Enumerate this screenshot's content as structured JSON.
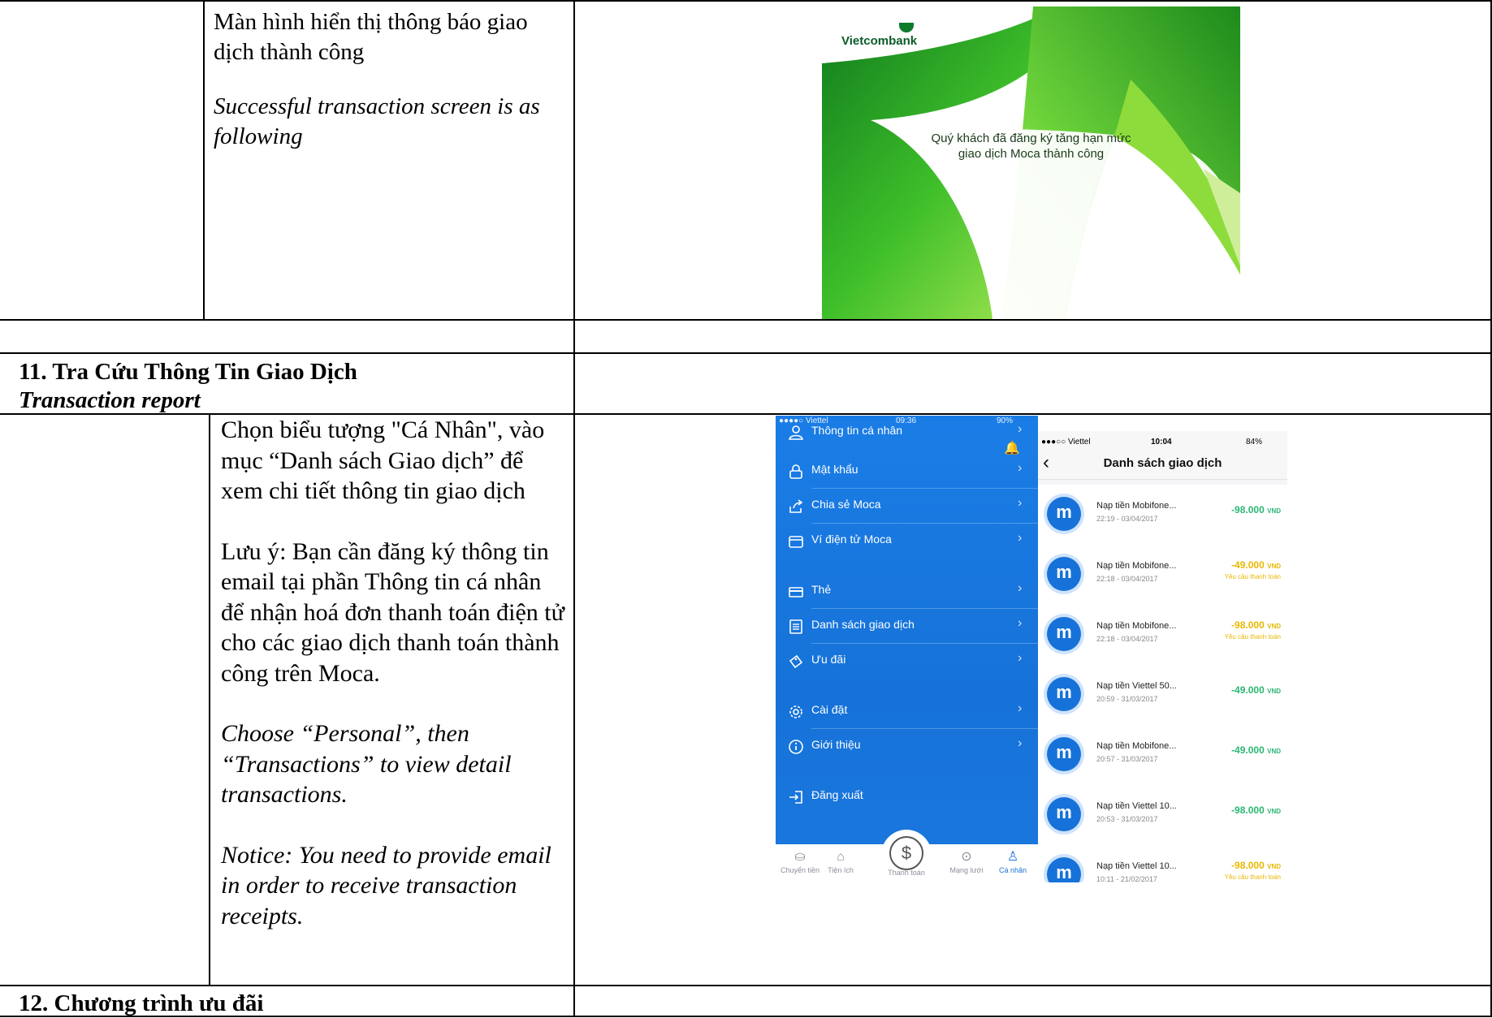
{
  "row1": {
    "vn": "Màn hình hiển thị thông báo giao dịch thành công",
    "en": "Successful transaction screen is as following",
    "screenshot": {
      "logo": "Vietcombank",
      "message_line1": "Quý khách đã đăng ký tăng hạn mức",
      "message_line2": "giao dịch Moca thành công"
    }
  },
  "section11": {
    "title": "11. Tra Cứu Thông Tin Giao Dịch",
    "subtitle": "Transaction report"
  },
  "row11": {
    "vn1": "Chọn biểu tượng \"Cá Nhân\", vào mục “Danh sách Giao dịch” để xem chi tiết thông tin giao dịch",
    "vn2": "Lưu ý: Bạn cần đăng ký thông tin email tại phần Thông tin cá nhân để nhận hoá đơn thanh toán điện tử cho các giao dịch thanh toán thành công trên Moca.",
    "en1": "Choose “Personal”, then “Transactions” to view detail transactions.",
    "en2": "Notice: You need to provide email in order to receive transaction receipts."
  },
  "moca_menu": {
    "status_carrier": "●●●●○ Viettel",
    "status_time": "09:36",
    "status_battery": "90%",
    "items": [
      {
        "label": "Thông tin cá nhân",
        "icon": "user-icon"
      },
      {
        "label": "Mật khẩu",
        "icon": "lock-icon"
      },
      {
        "label": "Chia sẻ Moca",
        "icon": "share-icon"
      },
      {
        "label": "Ví điện tử Moca",
        "icon": "wallet-icon"
      },
      {
        "label": "Thẻ",
        "icon": "card-icon"
      },
      {
        "label": "Danh sách giao dịch",
        "icon": "list-icon"
      },
      {
        "label": "Ưu đãi",
        "icon": "tag-icon"
      },
      {
        "label": "Cài đặt",
        "icon": "gear-icon"
      },
      {
        "label": "Giới thiệu",
        "icon": "info-icon"
      },
      {
        "label": "Đăng xuất",
        "icon": "logout-icon"
      }
    ],
    "tabs": [
      {
        "label": "Chuyển tiền"
      },
      {
        "label": "Tiện ích"
      },
      {
        "label": "Thanh toán"
      },
      {
        "label": "Mạng lưới"
      },
      {
        "label": "Cá nhân"
      }
    ]
  },
  "moca_list": {
    "status_carrier": "●●●○○ Viettel",
    "status_time": "10:04",
    "status_battery": "84%",
    "title": "Danh sách giao dịch",
    "avatar_letter": "m",
    "unit": "VND",
    "rows": [
      {
        "name": "Nạp tiền Mobifone...",
        "date": "22:19 - 03/04/2017",
        "amount": "-98.000",
        "note": "",
        "color": "#2bb673"
      },
      {
        "name": "Nạp tiền Mobifone...",
        "date": "22:18 - 03/04/2017",
        "amount": "-49.000",
        "note": "Yêu cầu thanh toán",
        "color": "#e6b800"
      },
      {
        "name": "Nạp tiền Mobifone...",
        "date": "22:18 - 03/04/2017",
        "amount": "-98.000",
        "note": "Yêu cầu thanh toán",
        "color": "#e6b800"
      },
      {
        "name": "Nạp tiền Viettel 50...",
        "date": "20:59 - 31/03/2017",
        "amount": "-49.000",
        "note": "",
        "color": "#2bb673"
      },
      {
        "name": "Nạp tiền Mobifone...",
        "date": "20:57 - 31/03/2017",
        "amount": "-49.000",
        "note": "",
        "color": "#2bb673"
      },
      {
        "name": "Nạp tiền Viettel 10...",
        "date": "20:53 - 31/03/2017",
        "amount": "-98.000",
        "note": "",
        "color": "#2bb673"
      },
      {
        "name": "Nạp tiền Viettel 10...",
        "date": "10:11 - 21/02/2017",
        "amount": "-98.000",
        "note": "Yêu cầu thanh toán",
        "color": "#e6b800"
      }
    ]
  },
  "section12": {
    "title": "12. Chương trình ưu đãi"
  }
}
